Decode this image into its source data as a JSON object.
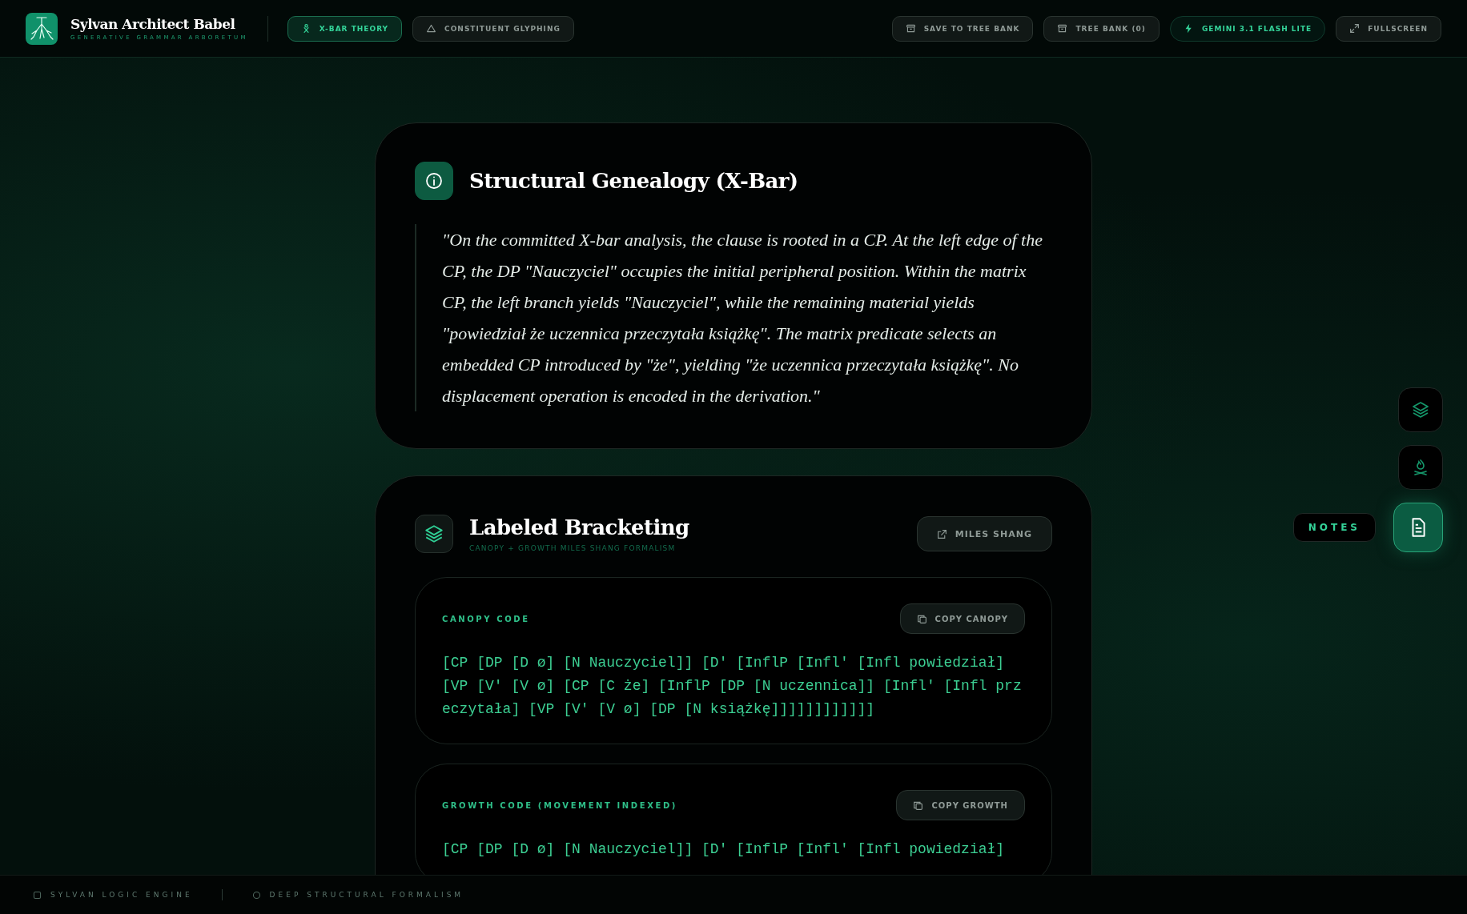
{
  "app": {
    "title": "Sylvan Architect Babel",
    "subtitle": "GENERATIVE GRAMMAR ARBORETUM"
  },
  "modes": [
    {
      "label": "X-BAR THEORY",
      "kind": "xbar",
      "selected": true
    },
    {
      "label": "CONSTITUENT GLYPHING",
      "kind": "triangle",
      "selected": false
    }
  ],
  "actions": [
    {
      "label": "SAVE TO TREE BANK",
      "kind": "archive",
      "selected": false
    },
    {
      "label": "TREE BANK (0)",
      "kind": "archive",
      "selected": false
    },
    {
      "label": "GEMINI 3.1 FLASH LITE",
      "kind": "bolt",
      "selected": true
    },
    {
      "label": "FULLSCREEN",
      "kind": "expand",
      "selected": false
    }
  ],
  "genealogy": {
    "title": "Structural Genealogy (X-Bar)",
    "quote": "\"On the committed X-bar analysis, the clause is rooted in a CP. At the left edge of the CP, the DP \"Nauczyciel\" occupies the initial peripheral position. Within the matrix CP, the left branch yields \"Nauczyciel\", while the remaining material yields \"powiedział że uczennica przeczytała książkę\". The matrix predicate selects an embedded CP introduced by \"że\", yielding \"że uczennica przeczytała książkę\". No displacement operation is encoded in the derivation.\""
  },
  "bracketing": {
    "title": "Labeled Bracketing",
    "subtitle": "CANOPY + GROWTH MILES SHANG FORMALISM",
    "link": "MILES SHANG",
    "blocks": [
      {
        "label": "CANOPY CODE",
        "button": "COPY CANOPY",
        "code": "[CP [DP [D ø] [N Nauczyciel]] [D' [InflP [Infl' [Infl powiedział] [VP [V' [V ø] [CP [C że] [InflP [DP [N uczennica]] [Infl' [Infl przeczytała] [VP [V' [V ø] [DP [N książkę]]]]]]]]]]]]"
      },
      {
        "label": "GROWTH CODE (MOVEMENT INDEXED)",
        "button": "COPY GROWTH",
        "code": "[CP [DP [D ø] [N Nauczyciel]] [D' [InflP [Infl' [Infl powiedział]"
      }
    ]
  },
  "rail": [
    {
      "kind": "layers",
      "selected": false
    },
    {
      "kind": "campfire",
      "selected": false
    },
    {
      "kind": "notes",
      "selected": true,
      "tooltip": "NOTES"
    }
  ],
  "footer": [
    {
      "label": "SYLVAN LOGIC ENGINE",
      "kind": "engine"
    },
    {
      "label": "DEEP STRUCTURAL FORMALISM",
      "kind": "formalism"
    }
  ]
}
